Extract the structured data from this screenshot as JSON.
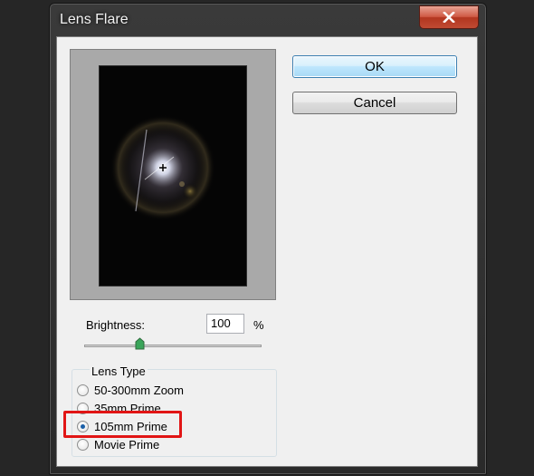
{
  "window": {
    "title": "Lens Flare"
  },
  "buttons": {
    "ok": "OK",
    "cancel": "Cancel"
  },
  "brightness": {
    "label": "Brightness:",
    "value": "100",
    "unit": "%",
    "slider_fraction": 0.3
  },
  "lens_type": {
    "legend": "Lens Type",
    "options": [
      {
        "label": "50-300mm Zoom",
        "checked": false
      },
      {
        "label": "35mm Prime",
        "checked": false
      },
      {
        "label": "105mm Prime",
        "checked": true
      },
      {
        "label": "Movie Prime",
        "checked": false
      }
    ]
  },
  "colors": {
    "highlight": "#e11515",
    "ok_border": "#3c7fb1",
    "close_button": "#c04a33"
  }
}
